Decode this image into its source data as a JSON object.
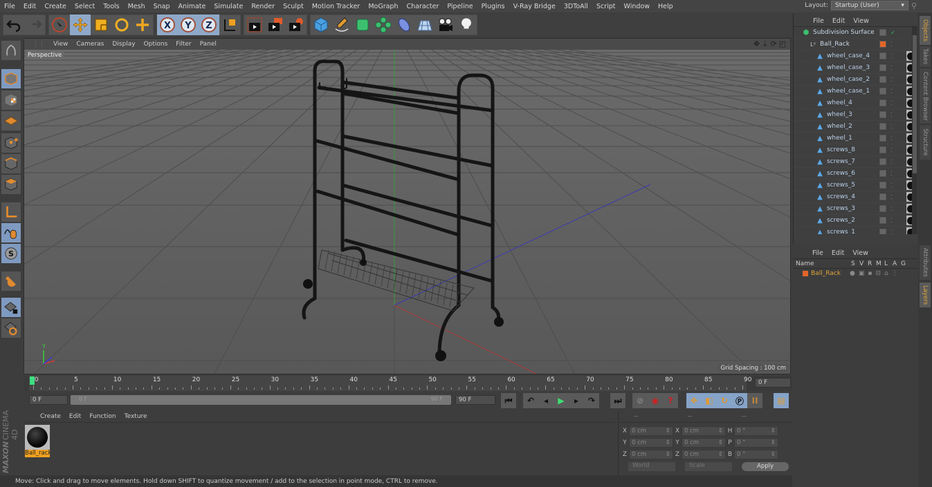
{
  "menubar": {
    "items": [
      "File",
      "Edit",
      "Create",
      "Select",
      "Tools",
      "Mesh",
      "Snap",
      "Animate",
      "Simulate",
      "Render",
      "Sculpt",
      "Motion Tracker",
      "MoGraph",
      "Character",
      "Pipeline",
      "Plugins",
      "V-Ray Bridge",
      "3DToAll",
      "Script",
      "Window",
      "Help"
    ],
    "layout_label": "Layout:",
    "layout_value": "Startup (User)"
  },
  "toolbar": {
    "groups": [
      [
        "undo-icon",
        "redo-icon"
      ],
      [
        "live-select-icon",
        "move-icon",
        "scale-icon",
        "rotate-icon",
        "add-object-icon"
      ],
      [
        "x-axis-icon",
        "y-axis-icon",
        "z-axis-icon",
        "coordinate-system-icon"
      ],
      [
        "render-view-icon",
        "render-picture-viewer-icon",
        "render-settings-icon"
      ],
      [
        "cube-icon",
        "pen-icon",
        "subdivision-icon",
        "cloner-icon",
        "deformer-icon",
        "floor-icon",
        "camera-icon",
        "light-icon"
      ]
    ]
  },
  "left_tools": [
    "make-editable-icon",
    "model-mode-icon",
    "texture-mode-icon",
    "workplane-icon",
    "points-mode-icon",
    "edges-mode-icon",
    "polygons-mode-icon",
    "axis-mode-icon",
    "tweak-icon",
    "solo-icon",
    "snap-magnet-icon",
    "workplane-lock-icon",
    "workplane-rotate-icon"
  ],
  "viewport": {
    "menu": [
      "View",
      "Cameras",
      "Display",
      "Options",
      "Filter",
      "Panel"
    ],
    "camera_label": "Perspective",
    "grid_spacing": "Grid Spacing : 100 cm",
    "nav_icons": [
      "pan-icon",
      "dolly-icon",
      "orbit-icon",
      "maximize-icon"
    ]
  },
  "timeline": {
    "ticks": [
      "0",
      "5",
      "10",
      "15",
      "20",
      "25",
      "30",
      "35",
      "40",
      "45",
      "50",
      "55",
      "60",
      "65",
      "70",
      "75",
      "80",
      "85",
      "90"
    ],
    "current_frame": "0 F",
    "start_field": "0 F",
    "range_start": "0 F",
    "range_end": "90 F",
    "end_field": "90 F"
  },
  "playback": {
    "buttons": [
      "go-to-start-icon",
      "previous-key-icon",
      "previous-frame-icon",
      "play-icon",
      "next-frame-icon",
      "next-key-icon",
      "go-to-end-icon",
      "motion-record-icon",
      "autokey-icon",
      "keyframe-selection-icon",
      "key-position-icon",
      "key-scale-icon",
      "key-rotation-icon",
      "key-param-icon",
      "key-pla-icon",
      "timeline-icon"
    ]
  },
  "material_panel": {
    "menu": [
      "Create",
      "Edit",
      "Function",
      "Texture"
    ],
    "materials": [
      {
        "name": "Ball_rack"
      }
    ],
    "brand_1": "MAXON",
    "brand_2": "CINEMA 4D"
  },
  "coordinates": {
    "headers": [
      "--",
      "--",
      "--"
    ],
    "rows": [
      {
        "l1": "X",
        "v1": "0 cm",
        "l2": "X",
        "v2": "0 cm",
        "l3": "H",
        "v3": "0 °"
      },
      {
        "l1": "Y",
        "v1": "0 cm",
        "l2": "Y",
        "v2": "0 cm",
        "l3": "P",
        "v3": "0 °"
      },
      {
        "l1": "Z",
        "v1": "0 cm",
        "l2": "Z",
        "v2": "0 cm",
        "l3": "B",
        "v3": "0 °"
      }
    ],
    "mode": "World",
    "type": "Scale",
    "apply": "Apply"
  },
  "status": "Move: Click and drag to move elements. Hold down SHIFT to quantize movement / add to the selection in point mode, CTRL to remove.",
  "object_manager": {
    "menu": [
      "File",
      "Edit",
      "View"
    ],
    "objects": [
      {
        "name": "Subdivision Surface",
        "level": 0,
        "type": "subdivision"
      },
      {
        "name": "Ball_Rack",
        "level": 1,
        "type": "null"
      },
      {
        "name": "wheel_case_4",
        "level": 2,
        "type": "mesh"
      },
      {
        "name": "wheel_case_3",
        "level": 2,
        "type": "mesh"
      },
      {
        "name": "wheel_case_2",
        "level": 2,
        "type": "mesh"
      },
      {
        "name": "wheel_case_1",
        "level": 2,
        "type": "mesh"
      },
      {
        "name": "wheel_4",
        "level": 2,
        "type": "mesh"
      },
      {
        "name": "wheel_3",
        "level": 2,
        "type": "mesh"
      },
      {
        "name": "wheel_2",
        "level": 2,
        "type": "mesh"
      },
      {
        "name": "wheel_1",
        "level": 2,
        "type": "mesh"
      },
      {
        "name": "screws_8",
        "level": 2,
        "type": "mesh"
      },
      {
        "name": "screws_7",
        "level": 2,
        "type": "mesh"
      },
      {
        "name": "screws_6",
        "level": 2,
        "type": "mesh"
      },
      {
        "name": "screws_5",
        "level": 2,
        "type": "mesh"
      },
      {
        "name": "screws_4",
        "level": 2,
        "type": "mesh"
      },
      {
        "name": "screws_3",
        "level": 2,
        "type": "mesh"
      },
      {
        "name": "screws_2",
        "level": 2,
        "type": "mesh"
      },
      {
        "name": "screws_1",
        "level": 2,
        "type": "mesh"
      }
    ]
  },
  "layer_manager": {
    "menu": [
      "File",
      "Edit",
      "View"
    ],
    "columns": [
      "Name",
      "S",
      "V",
      "R",
      "M",
      "L",
      "A",
      "G"
    ],
    "layers": [
      {
        "name": "Ball_Rack",
        "color": "#e0662a"
      }
    ]
  },
  "side_tabs": {
    "top": [
      "Objects",
      "Takes",
      "Content Browser",
      "Structure"
    ],
    "bottom": [
      "Attributes",
      "Layers"
    ]
  },
  "colors": {
    "accent": "#e0a43a",
    "layer": "#e0662a",
    "selected_tool": "#8fa8c8"
  }
}
